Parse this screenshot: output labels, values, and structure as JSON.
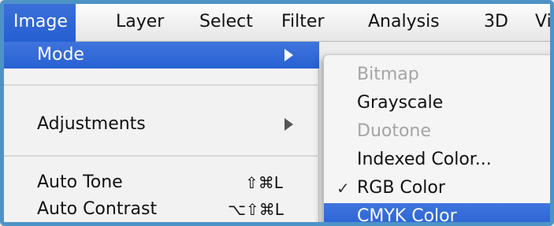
{
  "menubar": {
    "items": [
      "Image",
      "Layer",
      "Select",
      "Filter",
      "Analysis",
      "3D",
      "Vi"
    ]
  },
  "menu": {
    "mode": "Mode",
    "adjustments": "Adjustments",
    "auto_tone": {
      "label": "Auto Tone",
      "shortcut": "⇧⌘L"
    },
    "auto_contrast": {
      "label": "Auto Contrast",
      "shortcut": "⌥⇧⌘L"
    }
  },
  "submenu": {
    "items": [
      {
        "label": "Bitmap",
        "enabled": false
      },
      {
        "label": "Grayscale",
        "enabled": true
      },
      {
        "label": "Duotone",
        "enabled": false
      },
      {
        "label": "Indexed Color...",
        "enabled": true
      },
      {
        "label": "RGB Color",
        "enabled": true,
        "checked": true,
        "check_glyph": "✓"
      },
      {
        "label": "CMYK Color",
        "enabled": true,
        "highlighted": true
      }
    ]
  },
  "colors": {
    "highlight": "#2d66d6",
    "frame": "#4d93c6",
    "disabled_text": "#a4a4a4"
  }
}
